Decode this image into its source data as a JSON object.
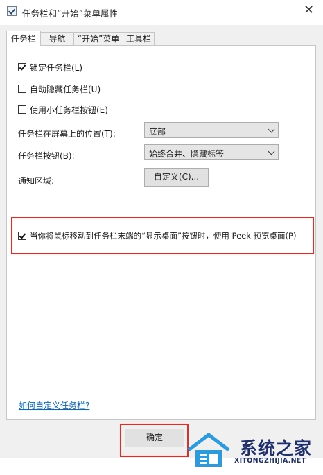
{
  "window": {
    "title": "任务栏和“开始”菜单属性",
    "close_glyph": "✕"
  },
  "tabs": [
    {
      "label": "任务栏",
      "active": true
    },
    {
      "label": "导航",
      "active": false
    },
    {
      "label": "“开始”菜单",
      "active": false
    },
    {
      "label": "工具栏",
      "active": false
    }
  ],
  "checkboxes": {
    "lock": {
      "label": "锁定任务栏(L)",
      "checked": true
    },
    "autohide": {
      "label": "自动隐藏任务栏(U)",
      "checked": false
    },
    "small": {
      "label": "使用小任务栏按钮(E)",
      "checked": false
    },
    "peek": {
      "label": "当你将鼠标移动到任务栏末端的“显示桌面”按钮时，使用 Peek 预览桌面(P)",
      "checked": true
    }
  },
  "fields": {
    "position": {
      "label": "任务栏在屏幕上的位置(T):",
      "value": "底部"
    },
    "buttons": {
      "label": "任务栏按钮(B):",
      "value": "始终合并、隐藏标签"
    },
    "notify": {
      "label": "通知区域:",
      "button": "自定义(C)..."
    }
  },
  "help_link": "如何自定义任务栏?",
  "footer": {
    "ok": "确定"
  },
  "watermark": {
    "cn": "系统之家",
    "en": "XITONGZHIJIA.NET"
  },
  "colors": {
    "highlight": "#d9302c",
    "link": "#0066cc",
    "watermark": "#1e2f6b"
  }
}
